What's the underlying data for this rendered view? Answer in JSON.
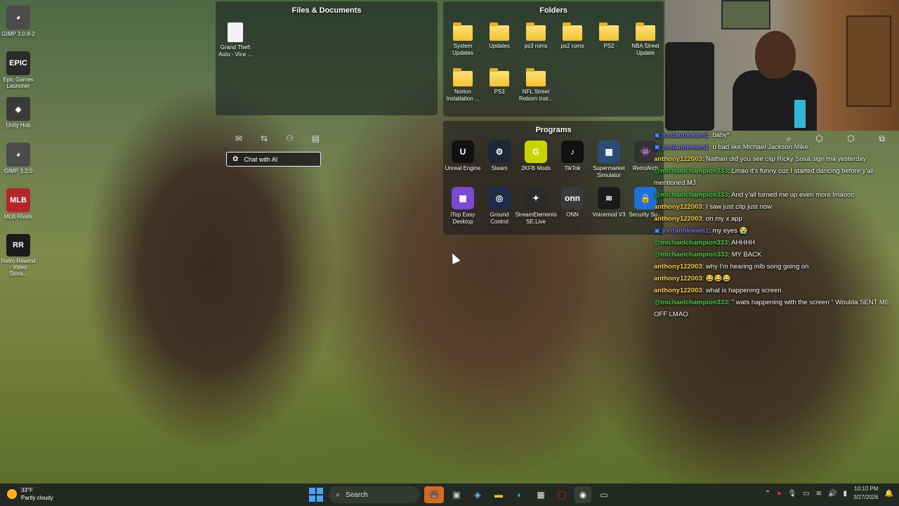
{
  "desktop_icons": [
    {
      "label": "GIMP 3.0.8-2",
      "icon": "gimp-icon",
      "color": "#4b4b4b",
      "glyph": "◕"
    },
    {
      "label": "Epic Games Launcher",
      "icon": "epic-games-icon",
      "color": "#2a2a2a",
      "glyph": "EPIC"
    },
    {
      "label": "Unity Hub",
      "icon": "unity-icon",
      "color": "#3a3a3a",
      "glyph": "◆"
    },
    {
      "label": "GIMP 3.2.0",
      "icon": "gimp-icon",
      "color": "#4b4b4b",
      "glyph": "◕"
    },
    {
      "label": "MLB Rivals",
      "icon": "mlb-rivals-icon",
      "color": "#b3262e",
      "glyph": "MLB"
    },
    {
      "label": "Retro Rewind - Video Stora...",
      "icon": "retro-rewind-icon",
      "color": "#1b1b1b",
      "glyph": "RR"
    }
  ],
  "files_fence": {
    "title": "Files & Documents",
    "items": [
      {
        "label": "Grand Theft Auto - Vice ..."
      }
    ]
  },
  "folders_fence": {
    "title": "Folders",
    "items": [
      {
        "label": "System Updates"
      },
      {
        "label": "Updates"
      },
      {
        "label": "ps3 roms"
      },
      {
        "label": "ps2 roms"
      },
      {
        "label": "PS2"
      },
      {
        "label": "NBA Street Update"
      },
      {
        "label": "Norton Installation ..."
      },
      {
        "label": "PS3"
      },
      {
        "label": "NFL Street Reborn Inst..."
      }
    ]
  },
  "programs_fence": {
    "title": "Programs",
    "items": [
      {
        "label": "Unreal Engine",
        "icon": "unreal-icon",
        "color": "#111111",
        "glyph": "U"
      },
      {
        "label": "Steam",
        "icon": "steam-icon",
        "color": "#1b2838",
        "glyph": "⚙"
      },
      {
        "label": "2KFB Mods",
        "icon": "2kfb-icon",
        "color": "#c9d400",
        "glyph": "G"
      },
      {
        "label": "TikTok",
        "icon": "tiktok-icon",
        "color": "#111111",
        "glyph": "♪"
      },
      {
        "label": "Supermarket Simulator",
        "icon": "supermarket-icon",
        "color": "#2d4b73",
        "glyph": "▦"
      },
      {
        "label": "RetroArch",
        "icon": "retroarch-icon",
        "color": "#333333",
        "glyph": "👾"
      },
      {
        "label": "iTop Easy Desktop",
        "icon": "itop-icon",
        "color": "#7a4bd1",
        "glyph": "▦"
      },
      {
        "label": "Ground Control",
        "icon": "ground-control-icon",
        "color": "#1d2a4a",
        "glyph": "◎"
      },
      {
        "label": "StreamElements SE.Live",
        "icon": "streamelements-icon",
        "color": "#2a2a2a",
        "glyph": "✦"
      },
      {
        "label": "ONN",
        "icon": "onn-icon",
        "color": "#3a3a3a",
        "glyph": "onn"
      },
      {
        "label": "Voicemod V3",
        "icon": "voicemod-icon",
        "color": "#1a1a1a",
        "glyph": "≋"
      },
      {
        "label": "Security Su...",
        "icon": "lock-icon",
        "color": "#1e6fd9",
        "glyph": "🔒"
      }
    ]
  },
  "chat_ai": {
    "label": "Chat with AI"
  },
  "chat": [
    {
      "user": "jordanokwam1",
      "text": ": baby*",
      "color": "#7c6cff",
      "badge": true
    },
    {
      "user": "jordanokwam1",
      "text": ": u bad like Michael Jackson Mike",
      "color": "#7c6cff",
      "badge": true
    },
    {
      "user": "anthony122003",
      "text": ": Nathan did you see clip Ricky Sosa sign tna yesterday",
      "color": "#ffd23a",
      "badge": false
    },
    {
      "user": "@michaelchampion333",
      "text": ": Lmao it's funny cuz I started dancing before y'all mentioned MJ",
      "color": "#3fd13f",
      "badge": false
    },
    {
      "user": "@michaelchampion333",
      "text": ": And y'all turned me up even more lmaooo",
      "color": "#3fd13f",
      "badge": false
    },
    {
      "user": "anthony122003",
      "text": ": I saw just clip just now",
      "color": "#ffd23a",
      "badge": false
    },
    {
      "user": "anthony122003",
      "text": ": on my x app",
      "color": "#ffd23a",
      "badge": false
    },
    {
      "user": "jordanokwam1",
      "text": ": my eyes 😭",
      "color": "#7c6cff",
      "badge": true
    },
    {
      "user": "@michaelchampion333",
      "text": ": AHHHH",
      "color": "#3fd13f",
      "badge": false
    },
    {
      "user": "@michaelchampion333",
      "text": ": MY BACK",
      "color": "#3fd13f",
      "badge": false
    },
    {
      "user": "anthony122003",
      "text": ": why I'm hearing mlb song going on",
      "color": "#ffd23a",
      "badge": false
    },
    {
      "user": "anthony122003",
      "text": ": 😂😂😂",
      "color": "#ffd23a",
      "badge": false
    },
    {
      "user": "anthony122003",
      "text": ": what is happening screen",
      "color": "#ffd23a",
      "badge": false
    },
    {
      "user": "@michaelchampion333",
      "text": ": \" wats happening with the screen \" Woulda SENT ME OFF LMAO",
      "color": "#3fd13f",
      "badge": false
    }
  ],
  "taskbar": {
    "weather_temp": "33°F",
    "weather_desc": "Partly cloudy",
    "search_label": "Search",
    "time": "10:10 PM",
    "date": "3/27/2026"
  }
}
